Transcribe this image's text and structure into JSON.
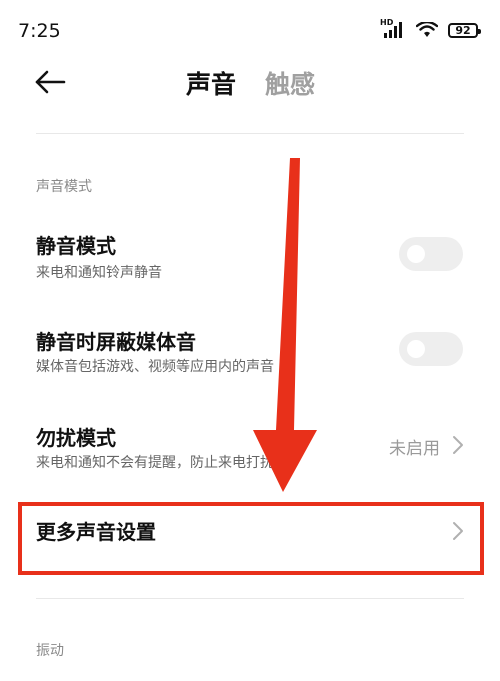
{
  "status_bar": {
    "time": "7:25",
    "network_label": "HD",
    "battery": "92"
  },
  "header": {
    "tabs": [
      {
        "label": "声音",
        "active": true
      },
      {
        "label": "触感",
        "active": false
      }
    ]
  },
  "sections": [
    {
      "label": "声音模式",
      "items": [
        {
          "title": "静音模式",
          "subtitle": "来电和通知铃声静音",
          "control": "toggle",
          "on": false
        },
        {
          "title": "静音时屏蔽媒体音",
          "subtitle": "媒体音包括游戏、视频等应用内的声音",
          "control": "toggle",
          "on": false
        },
        {
          "title": "勿扰模式",
          "subtitle": "来电和通知不会有提醒，防止来电打扰",
          "control": "chevron",
          "value": "未启用"
        },
        {
          "title": "更多声音设置",
          "control": "chevron"
        }
      ]
    },
    {
      "label": "振动"
    }
  ],
  "colors": {
    "annotation": "#e8301a",
    "toggle_off": "#eeeeee",
    "inactive_tab": "#a0a0a0"
  }
}
